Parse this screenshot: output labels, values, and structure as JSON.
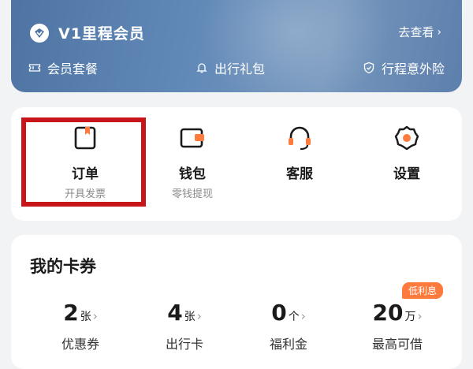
{
  "member": {
    "title": "V1里程会员",
    "see_more": "去查看",
    "benefits": [
      {
        "label": "会员套餐",
        "icon": "ticket-icon"
      },
      {
        "label": "出行礼包",
        "icon": "bell-icon"
      },
      {
        "label": "行程意外险",
        "icon": "shield-check-icon"
      }
    ]
  },
  "actions": [
    {
      "label": "订单",
      "sub": "开具发票",
      "icon": "order-icon"
    },
    {
      "label": "钱包",
      "sub": "零钱提现",
      "icon": "wallet-icon"
    },
    {
      "label": "客服",
      "sub": "",
      "icon": "headset-icon"
    },
    {
      "label": "设置",
      "sub": "",
      "icon": "gear-icon"
    }
  ],
  "coupons": {
    "title": "我的卡券",
    "tag": "低利息",
    "stats": [
      {
        "value": "2",
        "unit": "张",
        "label": "优惠券"
      },
      {
        "value": "4",
        "unit": "张",
        "label": "出行卡"
      },
      {
        "value": "0",
        "unit": "个",
        "label": "福利金"
      },
      {
        "value": "20",
        "unit": "万",
        "label": "最高可借"
      }
    ]
  },
  "colors": {
    "accent_orange": "#ff7a3d",
    "highlight_red": "#c8151a",
    "member_blue": "#5d7fac"
  }
}
